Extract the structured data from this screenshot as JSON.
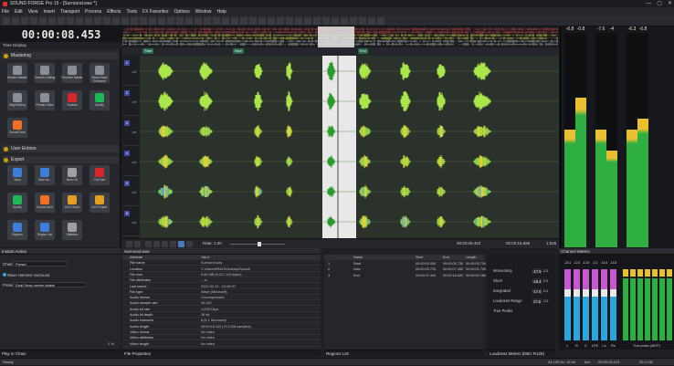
{
  "window": {
    "title": "SOUND FORGE Pro 15 - [Surround.wav *]",
    "min": "—",
    "max": "▢",
    "close": "✕"
  },
  "menu": [
    "File",
    "Edit",
    "View",
    "Insert",
    "Transport",
    "Process",
    "Effects",
    "Tools",
    "FX Favorites",
    "Options",
    "Window",
    "Help"
  ],
  "time_display": {
    "value": "00:00:08.453",
    "label": "Time Display"
  },
  "sections": {
    "mastering": "Mastering",
    "user_entries": "User Entries",
    "export": "Export"
  },
  "mastering_tiles": [
    {
      "label": "Modern Master",
      "color": "#8a8d94"
    },
    {
      "label": "Smooth Limiting",
      "color": "#8a8d94"
    },
    {
      "label": "Punchier Master",
      "color": "#8a8d94"
    },
    {
      "label": "Stereo Bass Enhancer",
      "color": "#8a8d94"
    },
    {
      "label": "Bright Boing",
      "color": "#8a8d94"
    },
    {
      "label": "Female Voice",
      "color": "#8a8d94"
    },
    {
      "label": "Youtube",
      "color": "#d7262a"
    },
    {
      "label": "Spotify",
      "color": "#1db954"
    },
    {
      "label": "SoundCloud",
      "color": "#f26f23"
    }
  ],
  "export_tiles": [
    {
      "label": "Save",
      "color": "#3e7dd8"
    },
    {
      "label": "Save As...",
      "color": "#3e7dd8"
    },
    {
      "label": "Burn CD",
      "color": "#a0a0a0"
    },
    {
      "label": "YouTube",
      "color": "#d7262a"
    },
    {
      "label": "Spotify",
      "color": "#1db954"
    },
    {
      "label": "SoundCloud",
      "color": "#f26f23"
    },
    {
      "label": "ACX Check",
      "color": "#e5a022"
    },
    {
      "label": "ACX Export",
      "color": "#e5a022"
    },
    {
      "label": "Regions",
      "color": "#3e7dd8"
    },
    {
      "label": "Region List",
      "color": "#3e7dd8"
    },
    {
      "label": "Statistics",
      "color": "#a0a0a0"
    }
  ],
  "markers": [
    {
      "label": "Start"
    },
    {
      "label": "Nice"
    },
    {
      "label": "End"
    }
  ],
  "channels": [
    {
      "num": "1",
      "db": "-Inf."
    },
    {
      "num": "2",
      "db": "-Inf."
    },
    {
      "num": "3",
      "db": "-Inf."
    },
    {
      "num": "4",
      "db": "-Inf."
    },
    {
      "num": "5",
      "db": "-Inf."
    },
    {
      "num": "6",
      "db": "-Inf."
    }
  ],
  "transport": {
    "rate": "Rate: 1.00",
    "pos1": "00:00:09.453",
    "pos2": "00:00:16.686",
    "zoom": "1:526"
  },
  "meter_values": [
    "-0.8",
    "-0.8",
    "-7.6",
    "-4",
    "-6.3",
    "-0.8",
    "-0.8",
    "-1",
    "-2.3",
    "-0.8"
  ],
  "instant": {
    "title": "Instant Action",
    "chain_label": "Chain",
    "chain_value": "Preset",
    "item": "Wave Hammer Surround",
    "preset_label": "Presets",
    "preset_value": "Dual Deep center-stable",
    "zoom": "1 %",
    "footer": "Play in Chain"
  },
  "props": {
    "tab": "Surround.wav",
    "col_attr": "Attribute",
    "col_val": "Value",
    "rows": [
      [
        "File name",
        "Surround.wav"
      ],
      [
        "Location",
        "C:\\Users\\PAKO\\Desktop\\Sound\\"
      ],
      [
        "File size",
        "8.60 MB (9,017,110 bytes)"
      ],
      [
        "File attributes",
        "---a--"
      ],
      [
        "Last saved",
        "2022-02-22 - 10:49:20"
      ],
      [
        "File type",
        "Wave (Microsoft)"
      ],
      [
        "Audio format",
        "Uncompressed"
      ],
      [
        "Audio sample rate",
        "44,100"
      ],
      [
        "Audio bit rate",
        "4,233 Kbps"
      ],
      [
        "Audio bit depth",
        "16 bit"
      ],
      [
        "Audio channels",
        "6 (5.1 Surround)"
      ],
      [
        "Audio length",
        "00:00:16.103 (710,108 samples)"
      ],
      [
        "Video format",
        "No video"
      ],
      [
        "Video attributes",
        "No video"
      ],
      [
        "Video length",
        "No video"
      ]
    ],
    "footer": "File Properties"
  },
  "regions": {
    "cols": [
      "",
      "Name",
      "Start",
      "End",
      "Length"
    ],
    "rows": [
      [
        "1",
        "Start",
        "00:00:00.000",
        "00:00:05.730",
        "00:00:05.730"
      ],
      [
        "2",
        "Nice",
        "00:00:05.723",
        "00:00:07.452",
        "00:00:01.729"
      ],
      [
        "3",
        "End",
        "00:00:07.440",
        "00:00:16.620",
        "00:00:09.180"
      ]
    ],
    "footer": "Regions List"
  },
  "loudness": {
    "rows": [
      {
        "label": "Momentary",
        "value": "-17.5",
        "unit": "LU"
      },
      {
        "label": "Short",
        "value": "-18.4",
        "unit": "LU"
      },
      {
        "label": "Integrated",
        "value": "-17.6",
        "unit": "LU"
      },
      {
        "label": "Loudness Range",
        "value": "17.6",
        "unit": "LU"
      },
      {
        "label": "True Peaks",
        "value": "",
        "unit": ""
      }
    ],
    "footer": "Loudness Meters (EBU R128)"
  },
  "channel_meters": {
    "title": "Channel Meters",
    "labels": [
      "L",
      "R",
      "C",
      "LFE",
      "Ls",
      "Rs"
    ],
    "peaks": [
      "-23.1",
      "-12.0",
      "-12.5",
      "-0.1",
      "-16.4",
      "-14.5"
    ],
    "footer_left": "M",
    "footer_right": "True peaks (dBTP)"
  },
  "status": {
    "left": "Ready",
    "fields": [
      "44,100 Hz",
      "16 bit",
      "6ch",
      "00:00:16.103",
      "33.4 GB"
    ]
  }
}
